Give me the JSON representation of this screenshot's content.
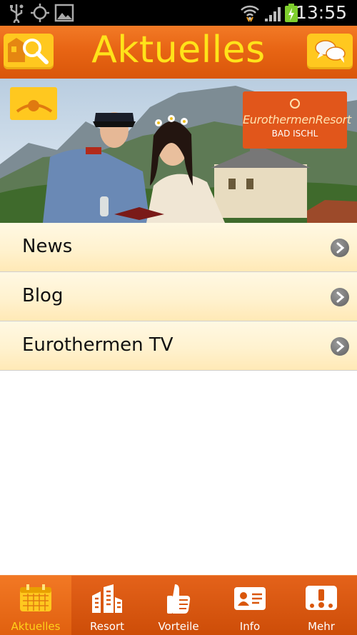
{
  "status_bar": {
    "time": "13:55"
  },
  "header": {
    "title": "Aktuelles"
  },
  "banner": {
    "logo_brand": "EurothermenResort",
    "logo_location": "BAD ISCHL"
  },
  "list": [
    {
      "label": "News"
    },
    {
      "label": "Blog"
    },
    {
      "label": "Eurothermen TV"
    }
  ],
  "tabs": [
    {
      "label": "Aktuelles",
      "icon": "calendar-icon",
      "active": true
    },
    {
      "label": "Resort",
      "icon": "building-icon",
      "active": false
    },
    {
      "label": "Vorteile",
      "icon": "thumbs-up-icon",
      "active": false
    },
    {
      "label": "Info",
      "icon": "id-card-icon",
      "active": false
    },
    {
      "label": "Mehr",
      "icon": "more-icon",
      "active": false
    }
  ],
  "colors": {
    "header_orange": "#e86514",
    "title_yellow": "#ffe31a",
    "button_yellow": "#ffc81f",
    "active_tab_label": "#ffd21a"
  }
}
